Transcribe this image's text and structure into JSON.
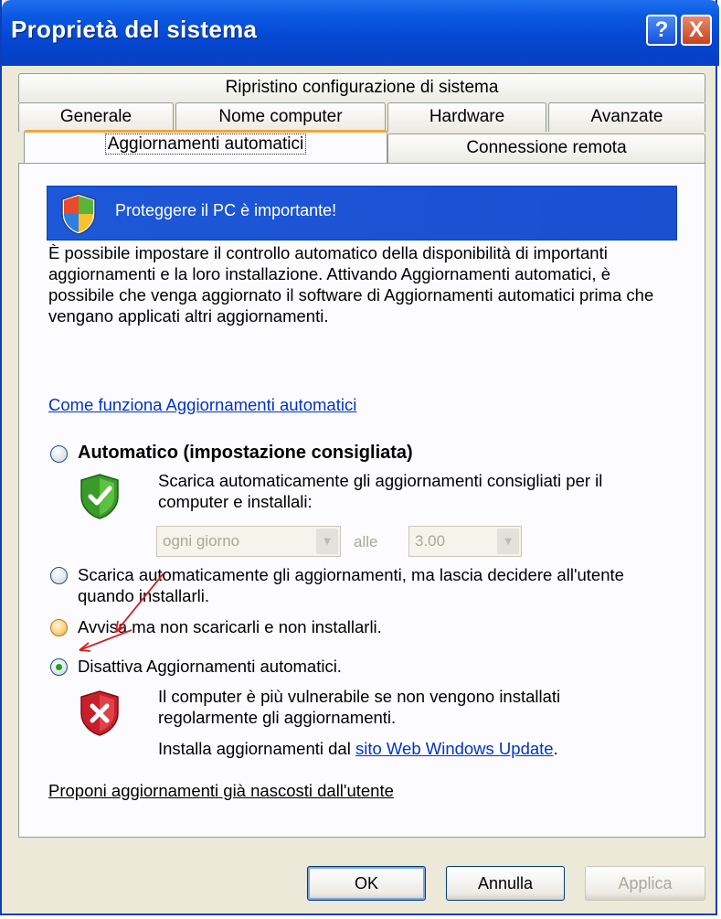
{
  "window": {
    "title": "Proprietà del sistema"
  },
  "titlebar_buttons": {
    "help": "?",
    "close": "X"
  },
  "tabs": {
    "row1": [
      "Ripristino configurazione di sistema"
    ],
    "row2": [
      "Generale",
      "Nome computer",
      "Hardware",
      "Avanzate"
    ],
    "row3": [
      "Aggiornamenti automatici",
      "Connessione remota"
    ],
    "active": "Aggiornamenti automatici"
  },
  "banner": {
    "text": "Proteggere il PC è importante!"
  },
  "description": "È possibile impostare il controllo automatico della disponibilità di importanti aggiornamenti e la loro installazione. Attivando Aggiornamenti automatici, è possibile che venga aggiornato il software di Aggiornamenti automatici prima che vengano applicati altri aggiornamenti.",
  "how_link": "Come funziona Aggiornamenti automatici",
  "options": {
    "automatic": {
      "label": "Automatico (impostazione consigliata)",
      "sub": "Scarica automaticamente gli aggiornamenti consigliati per il computer e installali:",
      "day_value": "ogni giorno",
      "at_label": "alle",
      "time_value": "3.00"
    },
    "download": {
      "label": "Scarica automaticamente gli aggiornamenti, ma lascia decidere all'utente quando installarli."
    },
    "notify": {
      "label": "Avvisa ma non scaricarli e non installarli."
    },
    "disable": {
      "label": "Disattiva Aggiornamenti automatici.",
      "warning": "Il computer è più vulnerabile se non vengono installati regolarmente gli aggiornamenti.",
      "install_prefix": "Installa aggiornamenti dal ",
      "install_link": "sito Web Windows Update",
      "install_suffix": "."
    },
    "selected": "disable"
  },
  "hidden_link": "Proponi aggiornamenti già nascosti dall'utente",
  "buttons": {
    "ok": "OK",
    "cancel": "Annulla",
    "apply": "Applica"
  },
  "colors": {
    "titlebar": "#0646d1",
    "banner": "#1d58d8",
    "link": "#0033cc",
    "annotation_arrow": "#d42020"
  }
}
